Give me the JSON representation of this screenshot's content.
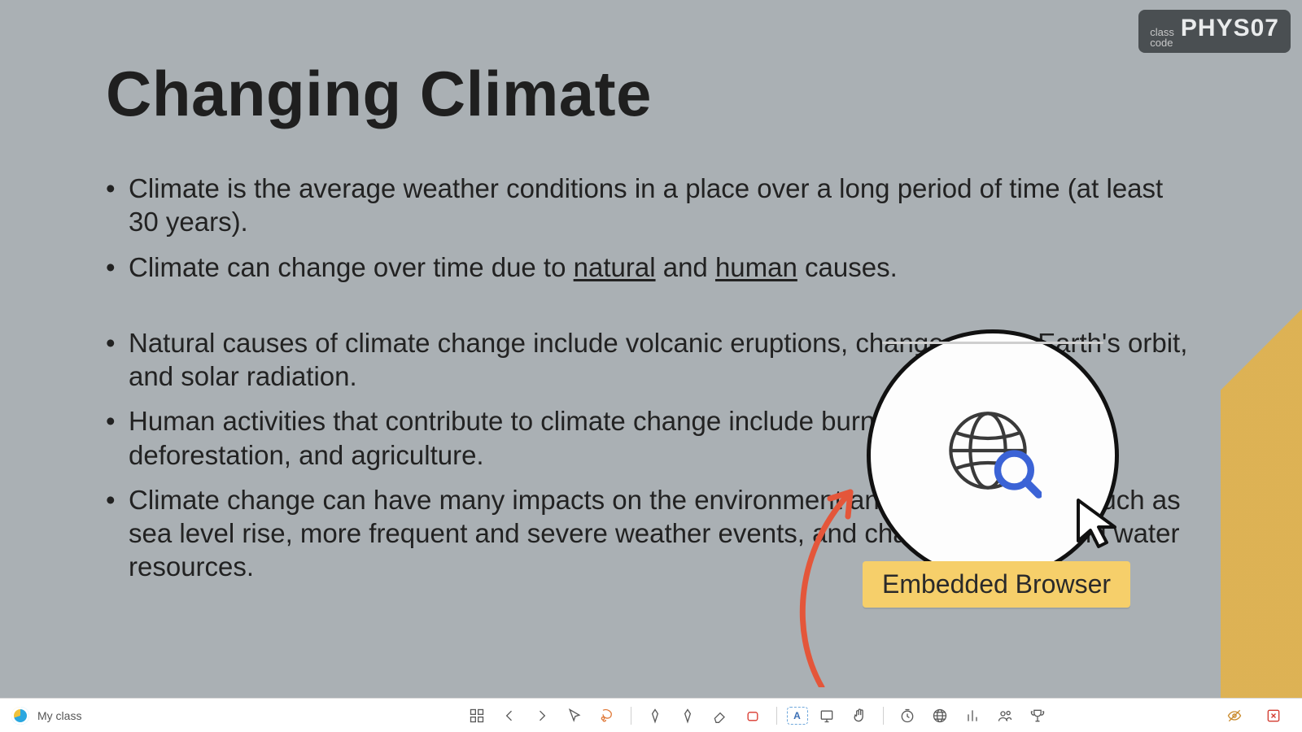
{
  "class_code": {
    "label1": "class",
    "label2": "code",
    "value": "PHYS07"
  },
  "slide": {
    "title": "Changing Climate",
    "bullets": [
      "Climate is the average weather conditions in a place over a long period of time (at least 30 years).",
      "Climate can change over time due to natural and human causes.",
      "Natural causes of climate change include volcanic eruptions, changes in the Earth's orbit, and solar radiation.",
      "Human activities that contribute to climate change include burning fossil fuels, deforestation, and agriculture.",
      "Climate change can have many impacts on the environment and human society, such as sea level rise, more frequent and severe weather events, and changes in food and water resources."
    ],
    "underlined_words": [
      "natural",
      "human"
    ]
  },
  "callout": {
    "tooltip": "Embedded Browser",
    "icon": "globe-search-icon"
  },
  "toolbar": {
    "class_label": "My class",
    "buttons": [
      {
        "name": "grid-icon",
        "label": "Apps"
      },
      {
        "name": "arrow-left-icon",
        "label": "Back"
      },
      {
        "name": "arrow-right-icon",
        "label": "Forward"
      },
      {
        "name": "pointer-icon",
        "label": "Select"
      },
      {
        "name": "lasso-icon",
        "label": "Lasso"
      },
      {
        "name": "pen-icon",
        "label": "Pen 1"
      },
      {
        "name": "pen2-icon",
        "label": "Pen 2"
      },
      {
        "name": "eraser-icon",
        "label": "Eraser"
      },
      {
        "name": "shape-icon",
        "label": "Shape"
      },
      {
        "name": "text-icon",
        "label": "Text"
      },
      {
        "name": "present-icon",
        "label": "Present"
      },
      {
        "name": "hand-icon",
        "label": "More tools"
      },
      {
        "name": "timer-icon",
        "label": "Timer"
      },
      {
        "name": "browser-icon",
        "label": "Embedded Browser"
      },
      {
        "name": "poll-icon",
        "label": "Poll"
      },
      {
        "name": "people-icon",
        "label": "Participants"
      },
      {
        "name": "trophy-icon",
        "label": "Leaderboard"
      }
    ],
    "right_buttons": [
      {
        "name": "eye-off-icon",
        "label": "Hide"
      },
      {
        "name": "close-icon",
        "label": "Close"
      }
    ]
  }
}
